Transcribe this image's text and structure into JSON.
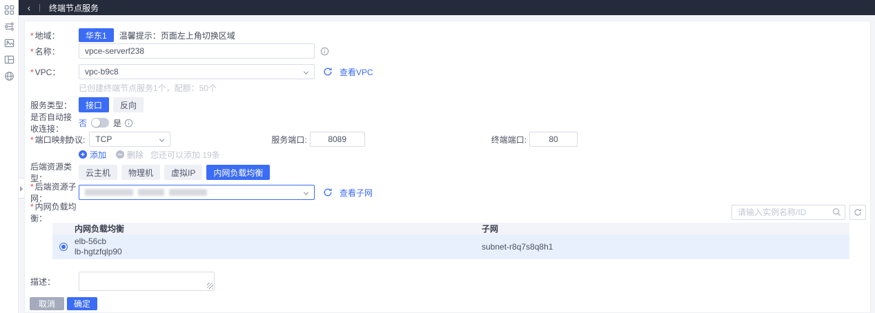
{
  "icons": {
    "back": "‹"
  },
  "sidebar": {
    "items": [
      "apps-grid",
      "workflow",
      "image",
      "layout",
      "globe"
    ]
  },
  "header": {
    "title": "终端节点服务"
  },
  "form": {
    "region": {
      "required": "*",
      "label": "地域：",
      "value": "华东1",
      "tip": "温馨提示：页面左上角切换区域"
    },
    "name": {
      "required": "*",
      "label": "名称：",
      "value": "vpce-serverf238"
    },
    "vpc": {
      "required": "*",
      "label": "VPC：",
      "value": "vpc-b9c8",
      "link": "查看VPC",
      "hint": "已创建终端节点服务1个，配额：50个"
    },
    "service_type": {
      "label": "服务类型：",
      "options": [
        "接口",
        "反向"
      ],
      "selected": "接口"
    },
    "auto_accept": {
      "label": "是否自动接收连接：",
      "off": "否",
      "on": "是",
      "state": "off"
    },
    "port_mapping": {
      "required": "*",
      "label": "端口映射：",
      "protocol_label": "协议:",
      "protocol": "TCP",
      "service_port_label": "服务端口:",
      "service_port": "8089",
      "endpoint_port_label": "终端端口:",
      "endpoint_port": "80",
      "add": "添加",
      "remove": "删除",
      "remaining": "您还可以添加 19条"
    },
    "backend_type": {
      "label": "后端资源类型：",
      "options": [
        "云主机",
        "物理机",
        "虚拟IP",
        "内网负载均衡"
      ],
      "selected": "内网负载均衡"
    },
    "backend_subnet": {
      "required": "*",
      "label": "后端资源子网：",
      "link": "查看子网",
      "value_redacted": true
    },
    "elb": {
      "required": "*",
      "label": "内网负载均衡：",
      "search_placeholder": "请输入实例名称/ID",
      "table": {
        "col_elb": "内网负载均衡",
        "col_subnet": "子网",
        "row": {
          "name": "elb-56cb",
          "id": "lb-hgtzfqlp90",
          "subnet": "subnet-r8q7s8q8h1",
          "selected": true
        }
      }
    },
    "description": {
      "label": "描述："
    },
    "actions": {
      "cancel": "取消",
      "confirm": "确定"
    }
  },
  "colors": {
    "primary": "#3b6cf5",
    "header_bg": "#252b3a",
    "required": "#e64545",
    "table_header_bg": "#f2f4f9",
    "row_selected_bg": "#e9f0fd",
    "link": "#3b6cf5"
  }
}
